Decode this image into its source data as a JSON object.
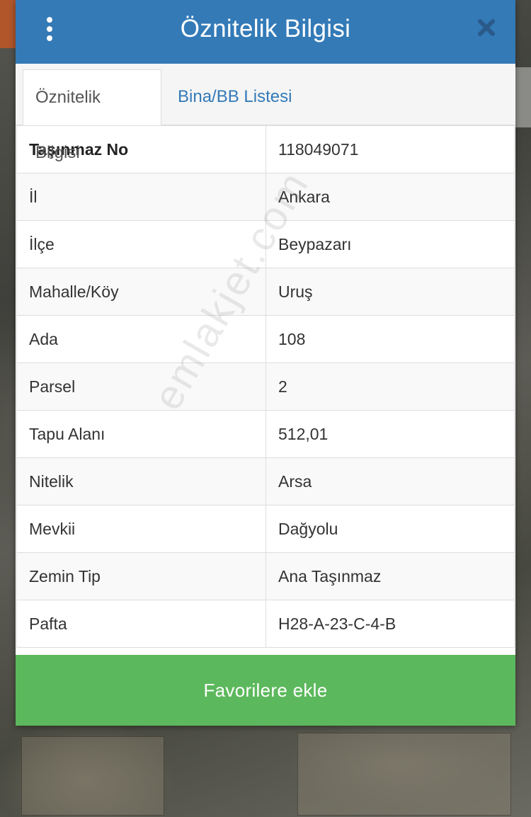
{
  "dialog": {
    "title": "Öznitelik Bilgisi",
    "header_color": "#337ab7"
  },
  "tabs": [
    {
      "label": "Öznitelik Bilgisi",
      "active": true
    },
    {
      "label": "Bina/BB Listesi",
      "active": false
    }
  ],
  "attributes": [
    {
      "key": "Taşınmaz No",
      "value": "118049071"
    },
    {
      "key": "İl",
      "value": "Ankara"
    },
    {
      "key": "İlçe",
      "value": "Beypazarı"
    },
    {
      "key": "Mahalle/Köy",
      "value": "Uruş"
    },
    {
      "key": "Ada",
      "value": "108"
    },
    {
      "key": "Parsel",
      "value": "2"
    },
    {
      "key": "Tapu Alanı",
      "value": "512,01"
    },
    {
      "key": "Nitelik",
      "value": "Arsa"
    },
    {
      "key": "Mevkii",
      "value": "Dağyolu"
    },
    {
      "key": "Zemin Tip",
      "value": "Ana Taşınmaz"
    },
    {
      "key": "Pafta",
      "value": "H28-A-23-C-4-B"
    }
  ],
  "favorite_button": {
    "label": "Favorilere ekle",
    "color": "#5cb85c"
  },
  "watermark": "emlakjet.com",
  "icons": {
    "menu": "vertical-ellipsis-icon",
    "close": "close-icon"
  }
}
